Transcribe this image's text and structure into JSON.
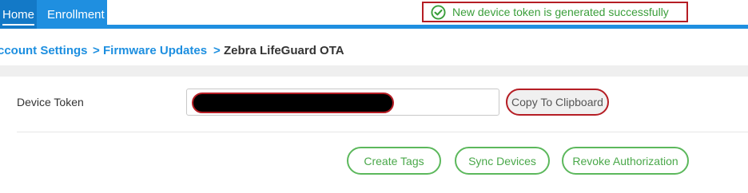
{
  "nav": {
    "home": "Home",
    "enrollment": "Enrollment"
  },
  "toast": {
    "message": "New device token is generated successfully",
    "icon": "check-circle-icon",
    "color": "#3a9e3a",
    "border_color": "#b51d24"
  },
  "breadcrumb": {
    "items": [
      "ccount Settings",
      "Firmware Updates",
      "Zebra LifeGuard OTA"
    ],
    "separator": ">"
  },
  "form": {
    "device_token_label": "Device Token",
    "device_token_value": "",
    "copy_button": "Copy To Clipboard"
  },
  "actions": {
    "create_tags": "Create Tags",
    "sync_devices": "Sync Devices",
    "revoke_authorization": "Revoke Authorization"
  },
  "colors": {
    "nav_bg": "#1f8fe0",
    "link": "#1d8fe0",
    "success": "#4aa84a",
    "highlight": "#b51d24"
  }
}
